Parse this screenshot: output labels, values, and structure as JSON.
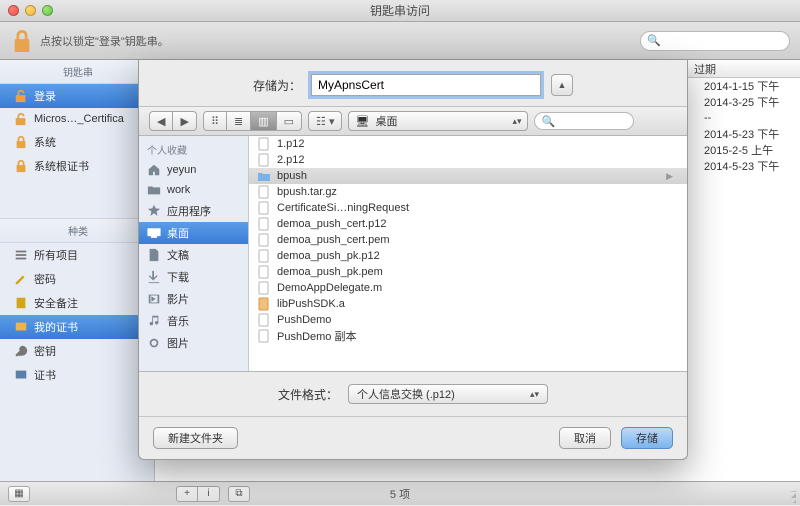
{
  "window": {
    "title": "钥匙串访问",
    "lock_hint": "点按以锁定\"登录\"钥匙串。"
  },
  "toolbar": {
    "search_placeholder": ""
  },
  "sidebar": {
    "group1_title": "钥匙串",
    "items1": [
      {
        "label": "登录"
      },
      {
        "label": "Micros…_Certifica"
      },
      {
        "label": "系统"
      },
      {
        "label": "系统根证书"
      }
    ],
    "group2_title": "种类",
    "items2": [
      {
        "label": "所有项目"
      },
      {
        "label": "密码"
      },
      {
        "label": "安全备注"
      },
      {
        "label": "我的证书"
      },
      {
        "label": "密钥"
      },
      {
        "label": "证书"
      }
    ]
  },
  "bg_table": {
    "header_expire": "过期",
    "rows": [
      "2014-1-15 下午",
      "2014-3-25 下午",
      "--",
      "2014-5-23 下午",
      "2015-2-5 上午",
      "2014-5-23 下午"
    ]
  },
  "statusbar": {
    "count": "5 项"
  },
  "sheet": {
    "save_as_label": "存储为：",
    "save_name": "MyApnsCert",
    "location_dropdown": "桌面",
    "favorites_title": "个人收藏",
    "favorites": [
      {
        "label": "yeyun",
        "icon": "home"
      },
      {
        "label": "work",
        "icon": "folder"
      },
      {
        "label": "应用程序",
        "icon": "apps"
      },
      {
        "label": "桌面",
        "icon": "desktop",
        "selected": true
      },
      {
        "label": "文稿",
        "icon": "docs"
      },
      {
        "label": "下载",
        "icon": "download"
      },
      {
        "label": "影片",
        "icon": "movies"
      },
      {
        "label": "音乐",
        "icon": "music"
      },
      {
        "label": "图片",
        "icon": "pictures"
      }
    ],
    "files": [
      {
        "name": "1.p12",
        "kind": "doc"
      },
      {
        "name": "2.p12",
        "kind": "doc"
      },
      {
        "name": "bpush",
        "kind": "folder",
        "selected": true,
        "hasChildren": true
      },
      {
        "name": "bpush.tar.gz",
        "kind": "doc"
      },
      {
        "name": "CertificateSi…ningRequest",
        "kind": "doc"
      },
      {
        "name": "demoa_push_cert.p12",
        "kind": "doc"
      },
      {
        "name": "demoa_push_cert.pem",
        "kind": "doc"
      },
      {
        "name": "demoa_push_pk.p12",
        "kind": "doc"
      },
      {
        "name": "demoa_push_pk.pem",
        "kind": "doc"
      },
      {
        "name": "DemoAppDelegate.m",
        "kind": "doc"
      },
      {
        "name": "libPushSDK.a",
        "kind": "orange"
      },
      {
        "name": "PushDemo",
        "kind": "doc"
      },
      {
        "name": "PushDemo 副本",
        "kind": "doc"
      }
    ],
    "format_label": "文件格式：",
    "format_value": "个人信息交换 (.p12)",
    "new_folder_btn": "新建文件夹",
    "cancel_btn": "取消",
    "save_btn": "存储"
  }
}
